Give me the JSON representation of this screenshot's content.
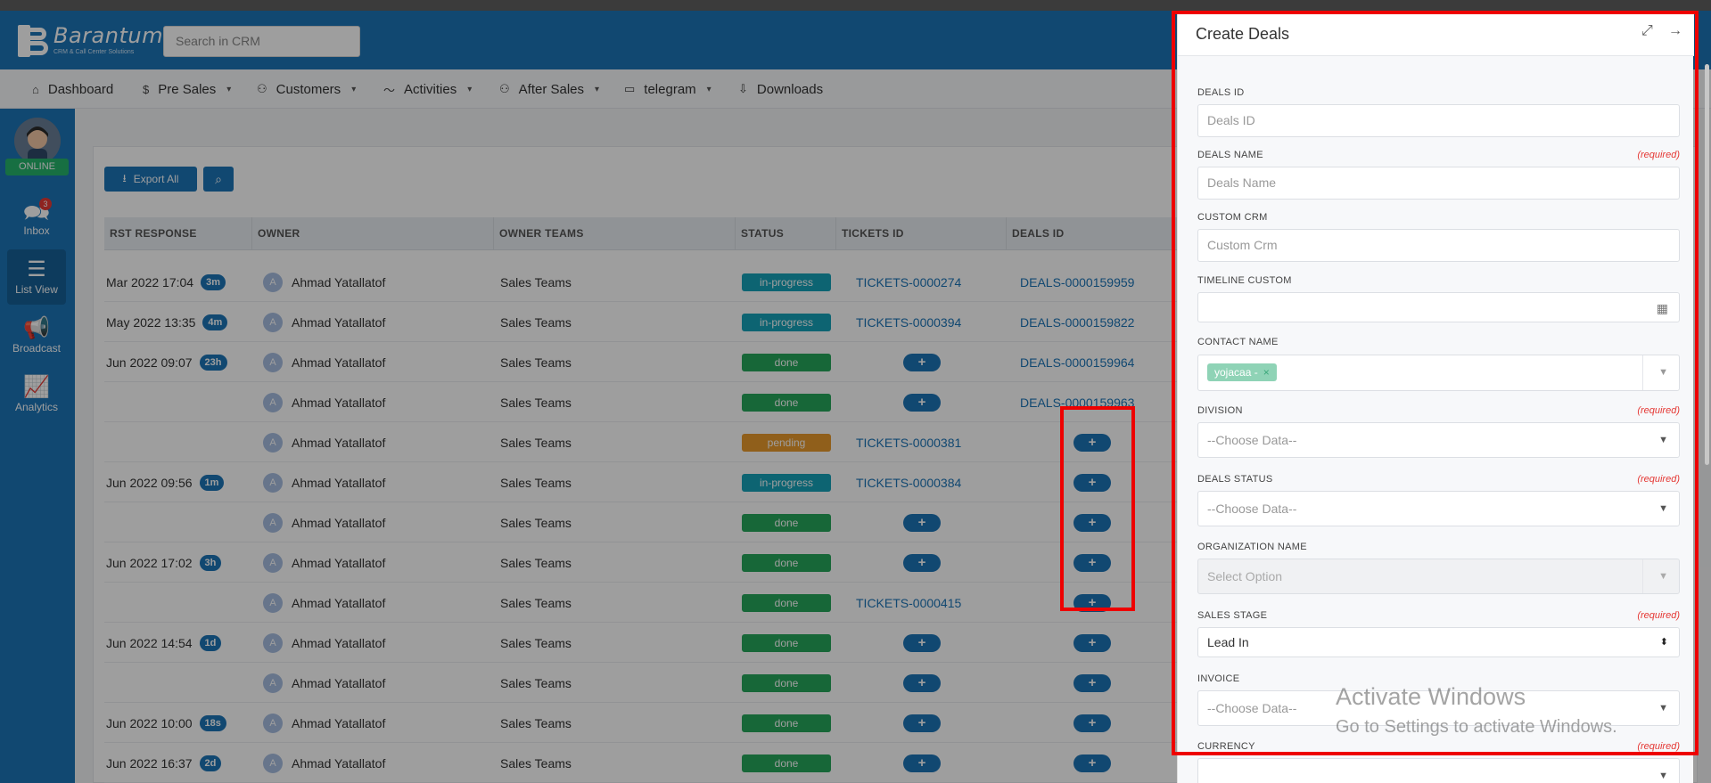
{
  "header": {
    "logo_name": "Barantum",
    "logo_tagline": "CRM & Call Center Solutions",
    "search_placeholder": "Search in CRM"
  },
  "nav": [
    {
      "label": "Dashboard",
      "icon": "home-icon"
    },
    {
      "label": "Pre Sales",
      "icon": "dollar-icon"
    },
    {
      "label": "Customers",
      "icon": "users-icon"
    },
    {
      "label": "Activities",
      "icon": "activity-icon"
    },
    {
      "label": "After Sales",
      "icon": "users-icon"
    },
    {
      "label": "telegram",
      "icon": "folder-icon"
    },
    {
      "label": "Downloads",
      "icon": "download-icon"
    }
  ],
  "sidebar": {
    "status": "ONLINE",
    "items": [
      {
        "label": "Inbox",
        "badge": "3"
      },
      {
        "label": "List View"
      },
      {
        "label": "Broadcast"
      },
      {
        "label": "Analytics"
      }
    ]
  },
  "toolbar": {
    "export_label": "Export All"
  },
  "table": {
    "columns": [
      "RST RESPONSE",
      "OWNER",
      "OWNER TEAMS",
      "STATUS",
      "TICKETS ID",
      "DEALS ID"
    ],
    "rows": [
      {
        "response": "Mar 2022 17:04",
        "pill": "3m",
        "owner": "Ahmad Yatallatof",
        "team": "Sales Teams",
        "status": "in-progress",
        "ticket": "TICKETS-0000274",
        "deal": "DEALS-0000159959"
      },
      {
        "response": "May 2022 13:35",
        "pill": "4m",
        "owner": "Ahmad Yatallatof",
        "team": "Sales Teams",
        "status": "in-progress",
        "ticket": "TICKETS-0000394",
        "deal": "DEALS-0000159822"
      },
      {
        "response": "Jun 2022 09:07",
        "pill": "23h",
        "owner": "Ahmad Yatallatof",
        "team": "Sales Teams",
        "status": "done",
        "ticket": "",
        "deal": "DEALS-0000159964"
      },
      {
        "response": "",
        "pill": "",
        "owner": "Ahmad Yatallatof",
        "team": "Sales Teams",
        "status": "done",
        "ticket": "",
        "deal": "DEALS-0000159963"
      },
      {
        "response": "",
        "pill": "",
        "owner": "Ahmad Yatallatof",
        "team": "Sales Teams",
        "status": "pending",
        "ticket": "TICKETS-0000381",
        "deal": ""
      },
      {
        "response": "Jun 2022 09:56",
        "pill": "1m",
        "owner": "Ahmad Yatallatof",
        "team": "Sales Teams",
        "status": "in-progress",
        "ticket": "TICKETS-0000384",
        "deal": ""
      },
      {
        "response": "",
        "pill": "",
        "owner": "Ahmad Yatallatof",
        "team": "Sales Teams",
        "status": "done",
        "ticket": "",
        "deal": ""
      },
      {
        "response": "Jun 2022 17:02",
        "pill": "3h",
        "owner": "Ahmad Yatallatof",
        "team": "Sales Teams",
        "status": "done",
        "ticket": "",
        "deal": ""
      },
      {
        "response": "",
        "pill": "",
        "owner": "Ahmad Yatallatof",
        "team": "Sales Teams",
        "status": "done",
        "ticket": "TICKETS-0000415",
        "deal": ""
      },
      {
        "response": "Jun 2022 14:54",
        "pill": "1d",
        "owner": "Ahmad Yatallatof",
        "team": "Sales Teams",
        "status": "done",
        "ticket": "",
        "deal": ""
      },
      {
        "response": "",
        "pill": "",
        "owner": "Ahmad Yatallatof",
        "team": "Sales Teams",
        "status": "done",
        "ticket": "",
        "deal": ""
      },
      {
        "response": "Jun 2022 10:00",
        "pill": "18s",
        "owner": "Ahmad Yatallatof",
        "team": "Sales Teams",
        "status": "done",
        "ticket": "",
        "deal": ""
      },
      {
        "response": "Jun 2022 16:37",
        "pill": "2d",
        "owner": "Ahmad Yatallatof",
        "team": "Sales Teams",
        "status": "done",
        "ticket": "",
        "deal": ""
      }
    ],
    "avatar_letter": "A",
    "add_glyph": "+"
  },
  "panel": {
    "title": "Create Deals",
    "required_text": "(required)",
    "fields": {
      "deals_id": {
        "label": "DEALS ID",
        "placeholder": "Deals ID"
      },
      "deals_name": {
        "label": "DEALS NAME",
        "placeholder": "Deals Name"
      },
      "custom_crm": {
        "label": "CUSTOM CRM",
        "placeholder": "Custom Crm"
      },
      "timeline_custom": {
        "label": "TIMELINE CUSTOM"
      },
      "contact_name": {
        "label": "CONTACT NAME",
        "tag": "yojacaa -"
      },
      "division": {
        "label": "DIVISION",
        "value": "--Choose Data--"
      },
      "deals_status": {
        "label": "DEALS STATUS",
        "value": "--Choose Data--"
      },
      "organization_name": {
        "label": "ORGANIZATION NAME",
        "value": "Select Option"
      },
      "sales_stage": {
        "label": "SALES STAGE",
        "value": "Lead In"
      },
      "invoice": {
        "label": "INVOICE",
        "value": "--Choose Data--"
      },
      "currency": {
        "label": "CURRENCY"
      }
    }
  },
  "watermark": {
    "line1": "Activate Windows",
    "line2": "Go to Settings to activate Windows."
  },
  "colors": {
    "brand": "#1c74b7",
    "highlight": "#e00000",
    "done": "#26a65b",
    "in_progress": "#16a2b8",
    "pending": "#e89a2c"
  }
}
